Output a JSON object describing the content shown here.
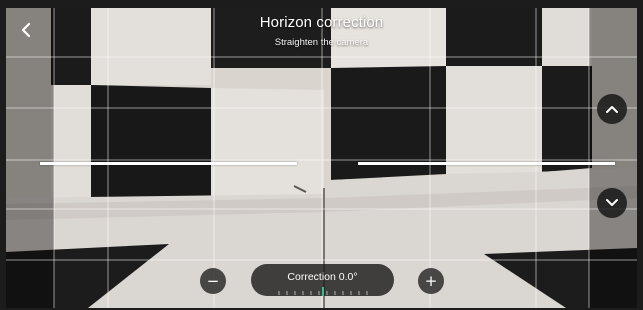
{
  "header": {
    "title": "Horizon correction",
    "subtitle": "Straighten the camera"
  },
  "controls": {
    "back_icon": "chevron-left-icon",
    "up_icon": "chevron-up-icon",
    "down_icon": "chevron-down-icon",
    "minus_label": "−",
    "plus_label": "+",
    "correction_label": "Correction  0.0°"
  },
  "colors": {
    "overlay_line": "#ffffff",
    "control_bg": "#1c1c1c",
    "tick_accent": "#2fbf8f"
  }
}
